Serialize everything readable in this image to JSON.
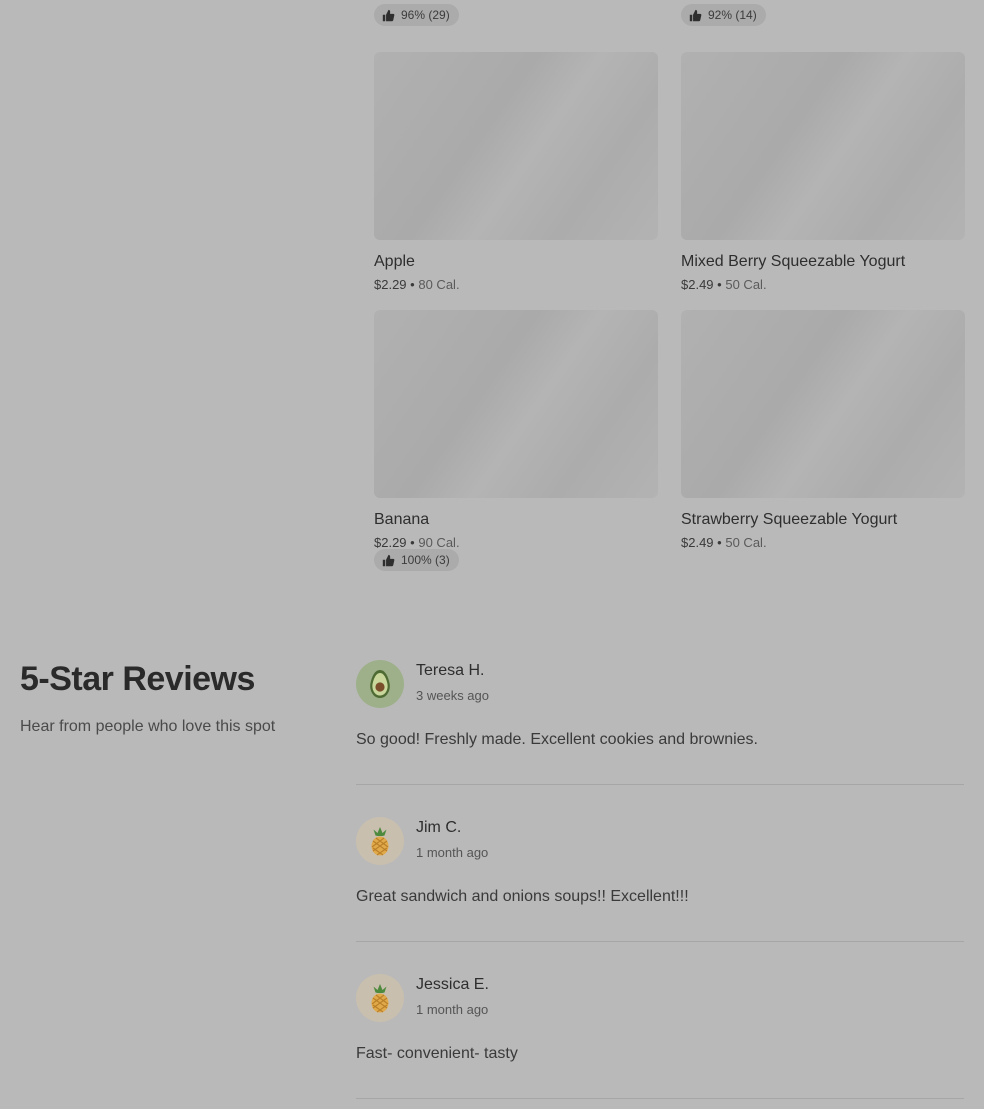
{
  "top_badges": [
    {
      "rating": "96% (29)"
    },
    {
      "rating": "92% (14)"
    }
  ],
  "items": [
    {
      "name": "Apple",
      "price": "$2.29",
      "calories": "80 Cal."
    },
    {
      "name": "Mixed Berry Squeezable Yogurt",
      "price": "$2.49",
      "calories": "50 Cal."
    },
    {
      "name": "Banana",
      "price": "$2.29",
      "calories": "90 Cal.",
      "rating": "100% (3)"
    },
    {
      "name": "Strawberry Squeezable Yogurt",
      "price": "$2.49",
      "calories": "50 Cal."
    }
  ],
  "separator": "•",
  "reviews_section": {
    "title": "5-Star Reviews",
    "subtitle": "Hear from people who love this spot"
  },
  "reviews": [
    {
      "name": "Teresa H.",
      "time": "3 weeks ago",
      "text": "So good! Freshly made. Excellent cookies and brownies.",
      "avatar_icon": "avocado-icon",
      "avatar_color": "#9db08a"
    },
    {
      "name": "Jim C.",
      "time": "1 month ago",
      "text": "Great sandwich and onions soups!! Excellent!!!",
      "avatar_icon": "pineapple-icon",
      "avatar_color": "#c9bfae"
    },
    {
      "name": "Jessica E.",
      "time": "1 month ago",
      "text": "Fast- convenient- tasty",
      "avatar_icon": "pineapple-icon",
      "avatar_color": "#c9bfae"
    }
  ]
}
